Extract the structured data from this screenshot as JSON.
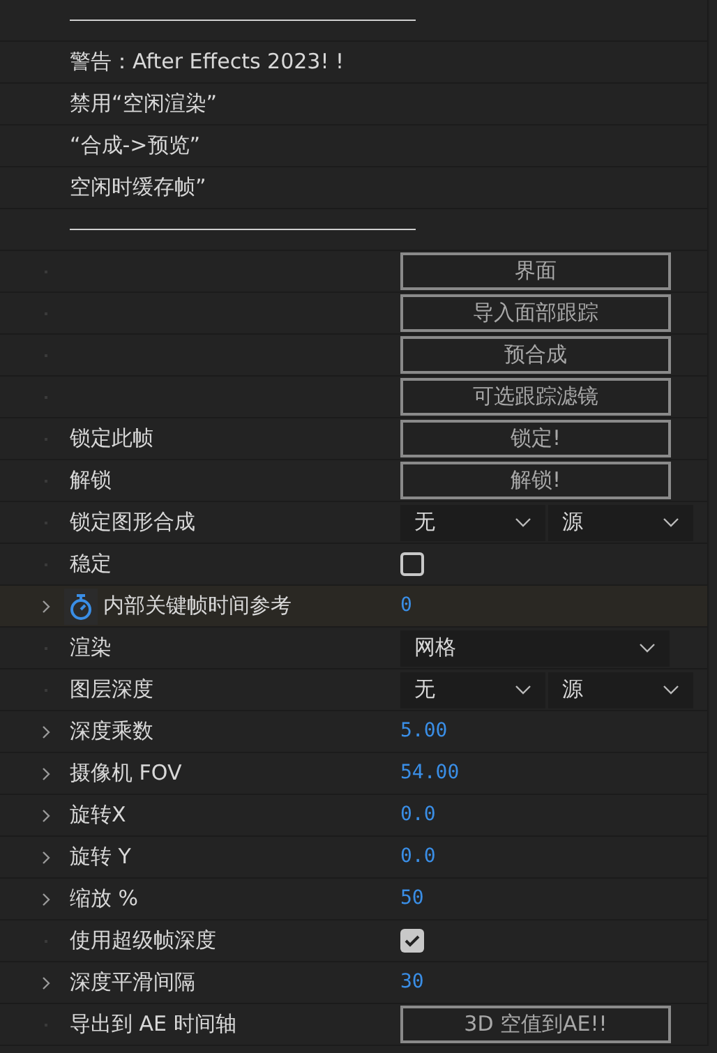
{
  "rows": [
    {
      "kind": "separator"
    },
    {
      "kind": "text",
      "label": "警告：After Effects 2023! !"
    },
    {
      "kind": "text",
      "label": "禁用“空闲渲染”"
    },
    {
      "kind": "text",
      "label": "“合成->预览”"
    },
    {
      "kind": "text",
      "label": "空闲时缓存帧”"
    },
    {
      "kind": "separator"
    },
    {
      "kind": "button",
      "expandable": false,
      "button": "界面"
    },
    {
      "kind": "button",
      "expandable": false,
      "button": "导入面部跟踪"
    },
    {
      "kind": "button",
      "expandable": false,
      "button": "预合成"
    },
    {
      "kind": "button",
      "expandable": false,
      "button": "可选跟踪滤镜"
    },
    {
      "kind": "button",
      "expandable": false,
      "label": "锁定此帧",
      "button": "锁定!"
    },
    {
      "kind": "button",
      "expandable": false,
      "label": "解锁",
      "button": "解锁!"
    },
    {
      "kind": "dropdowns",
      "expandable": false,
      "label": "锁定图形合成",
      "values": [
        "无",
        "源"
      ]
    },
    {
      "kind": "checkbox",
      "expandable": false,
      "label": "稳定",
      "checked": false
    },
    {
      "kind": "keyframe",
      "expandable": true,
      "label": "内部关键帧时间参考",
      "value": "0"
    },
    {
      "kind": "dropdown",
      "expandable": false,
      "label": "渲染",
      "values": [
        "网格"
      ]
    },
    {
      "kind": "dropdowns",
      "expandable": false,
      "label": "图层深度",
      "values": [
        "无",
        "源"
      ]
    },
    {
      "kind": "number",
      "expandable": true,
      "label": "深度乘数",
      "value": "5.00"
    },
    {
      "kind": "number",
      "expandable": true,
      "label": "摄像机 FOV",
      "value": "54.00"
    },
    {
      "kind": "number",
      "expandable": true,
      "label": "旋转X",
      "value": "0.0"
    },
    {
      "kind": "number",
      "expandable": true,
      "label": "旋转 Y",
      "value": "0.0"
    },
    {
      "kind": "number",
      "expandable": true,
      "label": "缩放 %",
      "value": "50"
    },
    {
      "kind": "checkbox",
      "expandable": false,
      "label": "使用超级帧深度",
      "checked": true
    },
    {
      "kind": "number",
      "expandable": true,
      "label": "深度平滑间隔",
      "value": "30"
    },
    {
      "kind": "button",
      "expandable": false,
      "label": "导出到 AE 时间轴",
      "button": "3D 空值到AE!!"
    }
  ]
}
